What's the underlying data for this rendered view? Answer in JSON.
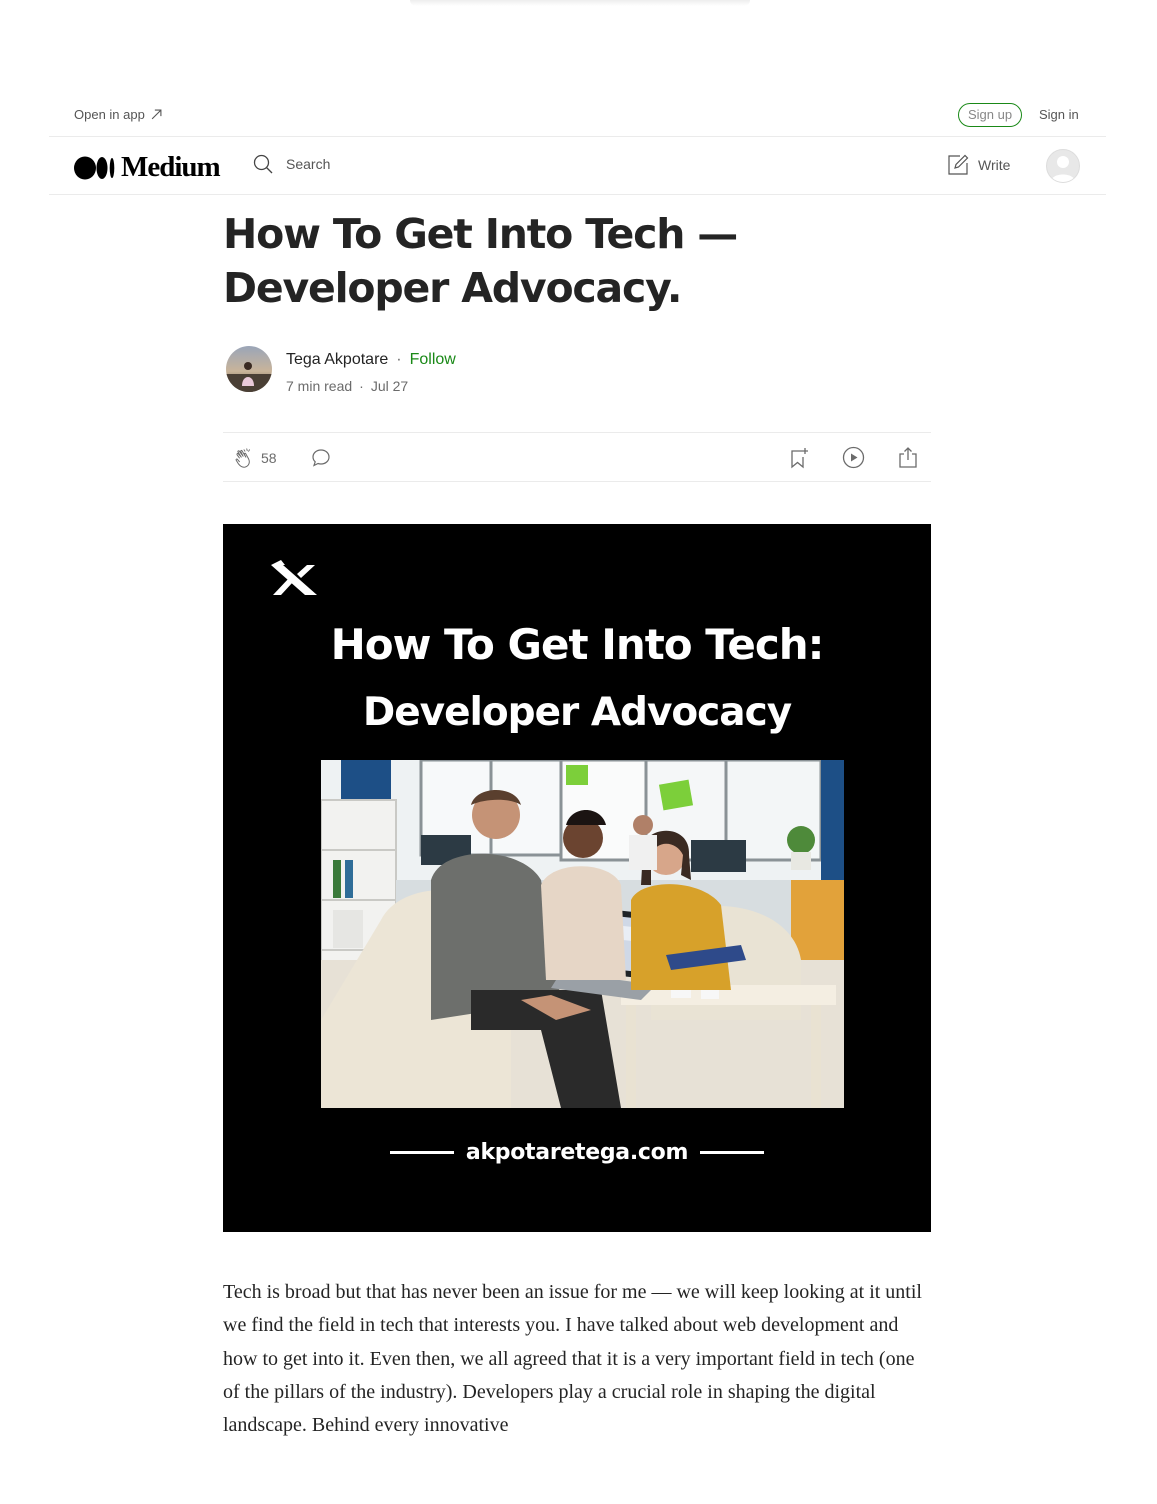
{
  "topbar": {
    "open_in_app": "Open in app",
    "sign_up": "Sign up",
    "sign_in": "Sign in"
  },
  "nav": {
    "logo_text": "Medium",
    "search_placeholder": "Search",
    "write_label": "Write"
  },
  "article": {
    "title": "How To Get Into Tech — Developer Advocacy.",
    "author": "Tega Akpotare",
    "follow_label": "Follow",
    "separator": "·",
    "read_time": "7 min read",
    "date": "Jul 27",
    "claps": "58",
    "hero": {
      "heading_line1": "How To Get Into Tech:",
      "heading_line2": "Developer Advocacy",
      "url": "akpotaretega.com"
    },
    "body": "Tech is broad but that has never been an issue for me — we will keep looking at it until we find the field in tech that interests you. I have talked about web development and how to get into it. Even then, we all agreed that it is a very important field in tech (one of the pillars of the industry). Developers play a crucial role in shaping the digital landscape. Behind every innovative"
  },
  "colors": {
    "accent_green": "#1a8917",
    "text": "#242424",
    "muted": "#6b6b6b"
  },
  "icons": [
    "arrow-up-right-icon",
    "medium-logo-icon",
    "search-icon",
    "write-icon",
    "user-avatar-icon",
    "clap-icon",
    "comment-icon",
    "bookmark-icon",
    "play-icon",
    "share-icon",
    "brand-mark-icon"
  ]
}
